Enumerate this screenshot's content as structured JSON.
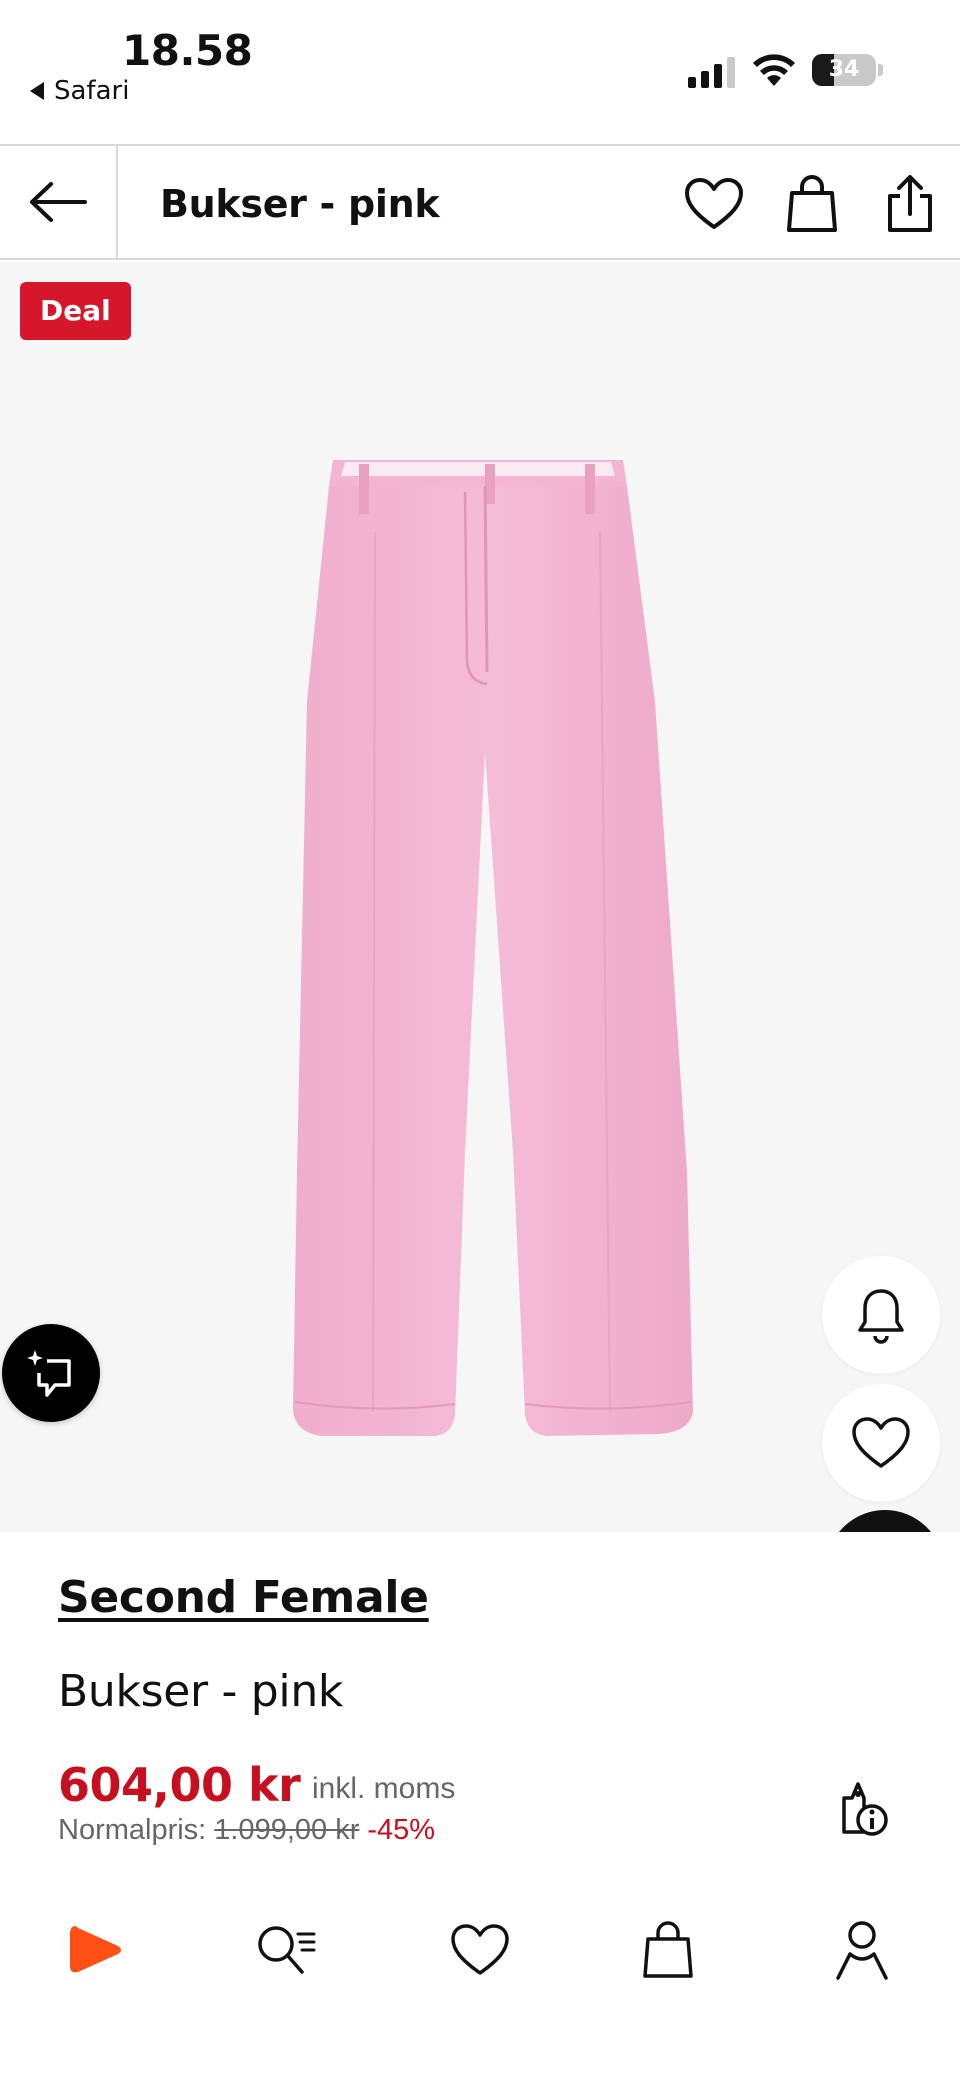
{
  "status_bar": {
    "time": "18.58",
    "back_app": "Safari",
    "battery_level": "34",
    "battery_fraction": 0.34
  },
  "header": {
    "title": "Bukser - pink",
    "icons": [
      "back-arrow-icon",
      "heart-icon",
      "bag-icon",
      "share-icon"
    ]
  },
  "product": {
    "badge": "Deal",
    "brand": "Second Female",
    "name": "Bukser - pink",
    "price": "604,00 kr",
    "vat_note": "inkl. moms",
    "normal_price_label": "Normalpris:",
    "normal_price": "1.099,00 kr",
    "discount": "-45%",
    "image_color": "#f3b5d1"
  },
  "floating_actions": [
    "bell-icon",
    "heart-icon",
    "ai-search-icon"
  ],
  "bottom_nav": [
    "home-logo-icon",
    "search-icon",
    "wishlist-icon",
    "bag-icon",
    "profile-icon"
  ],
  "colors": {
    "accent_red": "#c7101f",
    "deal_red": "#d6162a",
    "brand_orange": "#ff4f14",
    "image_bg": "#f6f6f6"
  }
}
